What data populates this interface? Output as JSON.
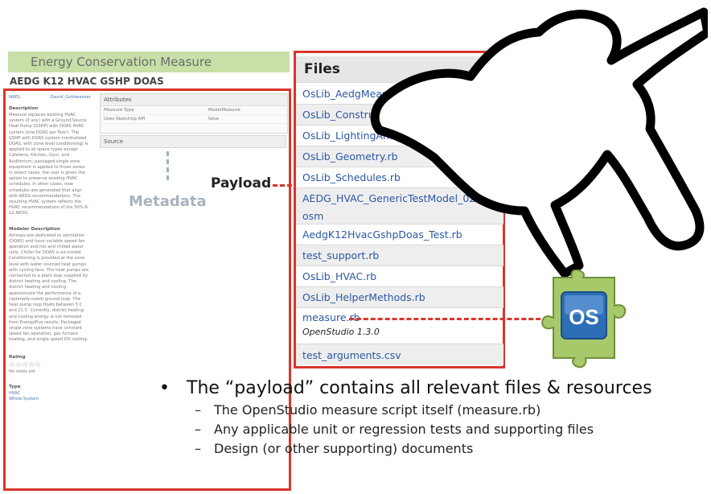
{
  "left_page": {
    "banner": "Energy Conservation Measure",
    "subtitle": "AEDG K12 HVAC GSHP DOAS",
    "authors": [
      "NREL",
      "David_Goldwasser"
    ],
    "description_heading": "Description",
    "description": "Measure replaces existing HVAC system (if any) with a Ground Source Heat Pump (GSHP) with DOAS HVAC system (one DOAS per floor). The GSHP with DOAS system (centralized DOAS, with zone level conditioning) is applied to all space types except Cafeteria, Kitchen, Gym, and Auditorium; packaged single zone equipment is applied to those zones. In select cases, the user is given the option to preserve existing HVAC schedules. In other cases, new schedules are generated that align with AEDG recommendations. The resulting HVAC system reflects the HVAC recommendations of the 50% K-12 AEDG.",
    "modeler_heading": "Modeler Description",
    "modeler_description": "Airloops are dedicated to ventilation (DOAS) and have variable speed fan operation and hot and chilled water coils. Chiller for DOAS is air-cooled. Conditioning is provided at the zone level with water sourced heat pumps with cycling fans. The heat pumps are connected to a plant loop supplied by district heating and cooling. The district heating and cooling approximate the performance of a (optimally-sized) ground loop. The heat pump loop floats between 5 C and 21 C. Currently, district heating and cooling energy is not removed from EnergyPlus results. Packaged single zone systems have constant speed fan operation, gas furnace heating, and single speed DX cooling.",
    "rating_heading": "Rating",
    "stars": "☆☆☆☆☆",
    "votes": "No votes yet",
    "type_heading": "Type",
    "type_values": [
      "HVAC",
      "Whole System"
    ],
    "attributes": {
      "title": "Attributes",
      "rows": [
        {
          "key": "Measure Type",
          "value": "ModelMeasure"
        },
        {
          "key": "Uses SketchUp API",
          "value": "false"
        }
      ]
    },
    "source_title": "Source",
    "metadata_label": "Metadata"
  },
  "files_panel": {
    "header": "Files",
    "files": [
      "OsLib_AedgMeasures.rb",
      "OsLib_Constructions.rb",
      "OsLib_LightingAndEquipment.rb",
      "OsLib_Geometry.rb",
      "OsLib_Schedules.rb",
      "AEDG_HVAC_GenericTestModel_0225_a.osm",
      "AedgK12HvacGshpDoas_Test.rb",
      "test_support.rb",
      "OsLib_HVAC.rb",
      "OsLib_HelperMethods.rb",
      "measure.rb",
      "test_arguments.csv"
    ],
    "os_version": "OpenStudio 1.3.0"
  },
  "payload_label": "Payload",
  "puzzle_logo_text": "OS",
  "bullets": {
    "main": "The “payload” contains all relevant files & resources",
    "subs": [
      "The OpenStudio measure script itself (measure.rb)",
      "Any applicable unit or regression tests and supporting files",
      "Design (or other supporting) documents"
    ]
  },
  "colors": {
    "frame_red": "#d9352b",
    "banner_green": "#c8dfa8",
    "link_blue": "#2b57a4",
    "puzzle_green": "#a8c96a",
    "os_blue": "#2d6fb6"
  }
}
